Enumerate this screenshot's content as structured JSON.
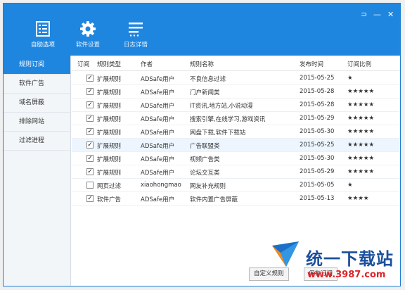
{
  "toolbar": {
    "items": [
      {
        "label": "自助选项",
        "icon": "list-icon",
        "active": true
      },
      {
        "label": "软件设置",
        "icon": "gear-icon",
        "active": false
      },
      {
        "label": "日志详情",
        "icon": "log-icon",
        "active": false
      }
    ]
  },
  "window_controls": {
    "restore": "⊃",
    "minimize": "—",
    "close": "✕"
  },
  "sidebar": {
    "items": [
      {
        "label": "规则订阅",
        "active": true
      },
      {
        "label": "软件广告",
        "active": false
      },
      {
        "label": "域名屏蔽",
        "active": false
      },
      {
        "label": "排除网站",
        "active": false
      },
      {
        "label": "过滤进程",
        "active": false
      }
    ]
  },
  "table": {
    "headers": [
      "订阅",
      "规则类型",
      "作者",
      "规则名称",
      "发布时间",
      "订阅比例"
    ],
    "rows": [
      {
        "checked": true,
        "type": "扩展规则",
        "author": "ADSafe用户",
        "name": "不良信息过滤",
        "date": "2015-05-25",
        "stars": 1,
        "highlight": false
      },
      {
        "checked": true,
        "type": "扩展规则",
        "author": "ADSafe用户",
        "name": "门户新闻类",
        "date": "2015-05-28",
        "stars": 5,
        "highlight": false
      },
      {
        "checked": true,
        "type": "扩展规则",
        "author": "ADSafe用户",
        "name": "IT资讯,地方站,小说动漫",
        "date": "2015-05-28",
        "stars": 5,
        "highlight": false
      },
      {
        "checked": true,
        "type": "扩展规则",
        "author": "ADSafe用户",
        "name": "搜索引擎,在线学习,游戏资讯",
        "date": "2015-05-29",
        "stars": 5,
        "highlight": false
      },
      {
        "checked": true,
        "type": "扩展规则",
        "author": "ADSafe用户",
        "name": "网盘下载,软件下载站",
        "date": "2015-05-30",
        "stars": 5,
        "highlight": false
      },
      {
        "checked": true,
        "type": "扩展规则",
        "author": "ADSafe用户",
        "name": "广告联盟类",
        "date": "2015-05-25",
        "stars": 5,
        "highlight": true
      },
      {
        "checked": true,
        "type": "扩展规则",
        "author": "ADSafe用户",
        "name": "视频广告类",
        "date": "2015-05-30",
        "stars": 5,
        "highlight": false
      },
      {
        "checked": true,
        "type": "扩展规则",
        "author": "ADSafe用户",
        "name": "论坛交互类",
        "date": "2015-05-29",
        "stars": 5,
        "highlight": false
      },
      {
        "checked": false,
        "type": "网页过滤",
        "author": "xiaohongmao",
        "name": "网友补充规则",
        "date": "2015-05-05",
        "stars": 1,
        "highlight": false
      },
      {
        "checked": true,
        "type": "软件广告",
        "author": "ADSafe用户",
        "name": "软件内置广告屏蔽",
        "date": "2015-05-13",
        "stars": 4,
        "highlight": false
      }
    ]
  },
  "buttons": {
    "custom_rule": "自定义规则",
    "save": "保存订阅"
  },
  "watermark": {
    "title": "统一下载站",
    "url": "www.3987.com"
  },
  "colors": {
    "accent": "#1f86e0",
    "star": "#f5a623",
    "watermark_title": "#1b4f9c",
    "watermark_url": "#d9262c"
  }
}
